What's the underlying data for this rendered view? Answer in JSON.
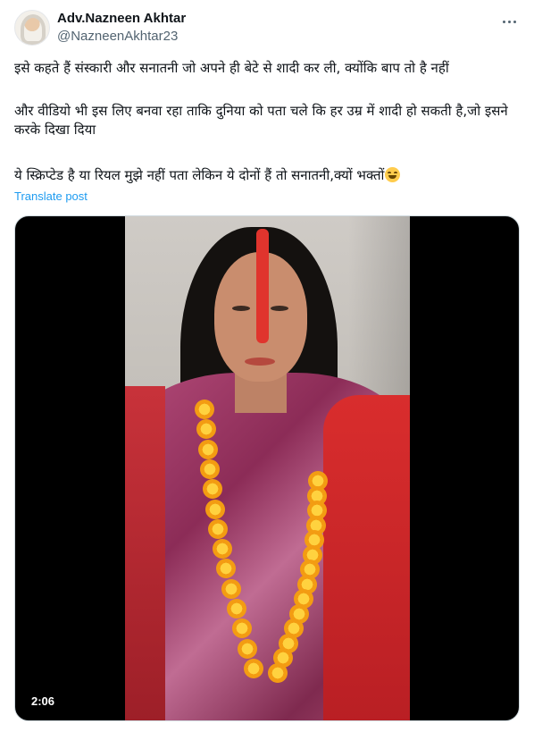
{
  "author": {
    "display_name": "Adv.Nazneen Akhtar",
    "handle": "@NazneenAkhtar23",
    "avatar_icon": "profile-photo-icon"
  },
  "post": {
    "paragraph_1": "इसे कहते हैं संस्कारी और सनातनी जो अपने ही बेटे से शादी कर ली, क्योंकि बाप तो है नहीं",
    "paragraph_2": "और वीडियो भी इस लिए बनवा रहा ताकि दुनिया को पता चले कि हर उम्र में शादी हो सकती है,जो इसने करके दिखा दिया",
    "paragraph_3": "ये स्क्रिप्टेड है या रियल मुझे नहीं पता लेकिन ये दोनों हैं तो सनातनी,क्यों भक्तों",
    "paragraph_3_emoji": "grinning-face-emoji",
    "translate_label": "Translate post"
  },
  "media": {
    "type": "video",
    "duration": "2:06"
  },
  "colors": {
    "text": "#0f1419",
    "secondary": "#536471",
    "link": "#1d9bf0",
    "border": "#cfd9de"
  },
  "icons": {
    "more": "more-options-icon"
  }
}
